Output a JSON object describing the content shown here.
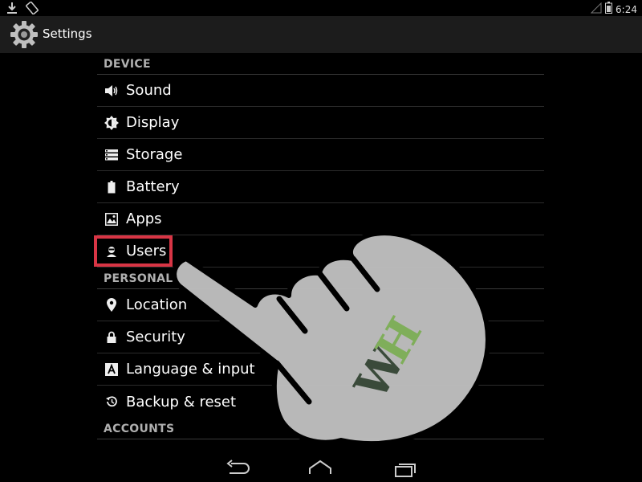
{
  "status_bar": {
    "time": "6:24",
    "left_icons": [
      "download-icon",
      "screen-rotation-icon"
    ],
    "right_icons": [
      "signal-icon",
      "battery-icon"
    ]
  },
  "action_bar": {
    "title": "Settings",
    "icon": "settings-gear-icon"
  },
  "sections": {
    "device": {
      "header": "DEVICE",
      "items": [
        {
          "label": "Sound",
          "icon": "volume-icon"
        },
        {
          "label": "Display",
          "icon": "brightness-icon"
        },
        {
          "label": "Storage",
          "icon": "storage-icon"
        },
        {
          "label": "Battery",
          "icon": "battery-icon"
        },
        {
          "label": "Apps",
          "icon": "apps-icon"
        },
        {
          "label": "Users",
          "icon": "user-icon"
        }
      ]
    },
    "personal": {
      "header": "PERSONAL",
      "items": [
        {
          "label": "Location",
          "icon": "location-pin-icon"
        },
        {
          "label": "Security",
          "icon": "lock-icon"
        },
        {
          "label": "Language & input",
          "icon": "keyboard-letter-icon"
        },
        {
          "label": "Backup & reset",
          "icon": "restore-icon"
        }
      ]
    },
    "accounts": {
      "header": "ACCOUNTS"
    }
  },
  "nav_bar": {
    "buttons": [
      "back-icon",
      "home-icon",
      "recents-icon"
    ]
  },
  "overlay": {
    "watermark": "WH",
    "highlight_color": "#d83545"
  }
}
